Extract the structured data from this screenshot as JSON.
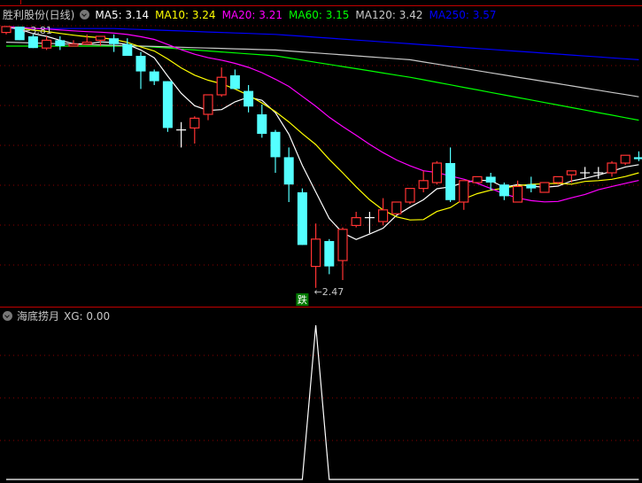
{
  "header": {
    "title": "胜利股份(日线)",
    "ma_labels": [
      {
        "text": "MA5: 3.14",
        "color": "#ffffff"
      },
      {
        "text": "MA10: 3.24",
        "color": "#ffff00"
      },
      {
        "text": "MA20: 3.21",
        "color": "#ff00ff"
      },
      {
        "text": "MA60: 3.15",
        "color": "#00ff00"
      },
      {
        "text": "MA120: 3.42",
        "color": "#c8c8c8"
      },
      {
        "text": "MA250: 3.57",
        "color": "#0000ff"
      }
    ]
  },
  "lower_panel": {
    "title": "海底捞月",
    "value_label": "XG: 0.00"
  },
  "annotations": {
    "high_label": "3.81",
    "low_label": "2.47",
    "signal_label": "跌"
  },
  "colors": {
    "up": "#ff3333",
    "down": "#54ffff",
    "flat": "#ffffff",
    "grid": "#8b0000",
    "separator": "#c00000",
    "signal_bg": "#007a00"
  },
  "chart_data": {
    "type": "candlestick",
    "price_range": [
      2.47,
      3.81
    ],
    "ohlc": [
      [
        3.78,
        3.81,
        3.77,
        3.81
      ],
      [
        3.81,
        3.81,
        3.74,
        3.74
      ],
      [
        3.76,
        3.77,
        3.7,
        3.7
      ],
      [
        3.7,
        3.76,
        3.69,
        3.74
      ],
      [
        3.74,
        3.76,
        3.69,
        3.71
      ],
      [
        3.71,
        3.74,
        3.71,
        3.72
      ],
      [
        3.72,
        3.77,
        3.72,
        3.73
      ],
      [
        3.74,
        3.76,
        3.71,
        3.76
      ],
      [
        3.75,
        3.77,
        3.68,
        3.72
      ],
      [
        3.72,
        3.75,
        3.66,
        3.66
      ],
      [
        3.66,
        3.68,
        3.49,
        3.58
      ],
      [
        3.58,
        3.59,
        3.51,
        3.53
      ],
      [
        3.53,
        3.53,
        3.27,
        3.29
      ],
      [
        3.28,
        3.32,
        3.19,
        3.28
      ],
      [
        3.29,
        3.35,
        3.21,
        3.34
      ],
      [
        3.36,
        3.46,
        3.33,
        3.46
      ],
      [
        3.46,
        3.6,
        3.45,
        3.55
      ],
      [
        3.56,
        3.59,
        3.49,
        3.49
      ],
      [
        3.48,
        3.51,
        3.37,
        3.4
      ],
      [
        3.36,
        3.41,
        3.24,
        3.26
      ],
      [
        3.27,
        3.28,
        3.06,
        3.14
      ],
      [
        3.14,
        3.19,
        2.91,
        3.0
      ],
      [
        2.96,
        2.98,
        2.69,
        2.69
      ],
      [
        2.58,
        2.8,
        2.47,
        2.72
      ],
      [
        2.71,
        2.72,
        2.54,
        2.58
      ],
      [
        2.61,
        2.78,
        2.51,
        2.77
      ],
      [
        2.79,
        2.86,
        2.78,
        2.83
      ],
      [
        2.83,
        2.86,
        2.75,
        2.83
      ],
      [
        2.81,
        2.93,
        2.79,
        2.87
      ],
      [
        2.85,
        2.91,
        2.85,
        2.91
      ],
      [
        2.91,
        2.98,
        2.9,
        2.98
      ],
      [
        2.98,
        3.07,
        2.96,
        3.02
      ],
      [
        3.01,
        3.12,
        3.0,
        3.11
      ],
      [
        3.11,
        3.19,
        2.91,
        2.92
      ],
      [
        2.91,
        3.02,
        2.87,
        3.02
      ],
      [
        3.01,
        3.04,
        3.01,
        3.04
      ],
      [
        3.04,
        3.06,
        2.97,
        3.01
      ],
      [
        3.0,
        3.01,
        2.92,
        2.94
      ],
      [
        2.91,
        3.02,
        2.91,
        2.99
      ],
      [
        3.0,
        3.04,
        2.96,
        2.98
      ],
      [
        2.96,
        3.01,
        2.96,
        3.01
      ],
      [
        3.01,
        3.04,
        3.0,
        3.04
      ],
      [
        3.05,
        3.07,
        3.01,
        3.07
      ],
      [
        3.06,
        3.09,
        3.03,
        3.06
      ],
      [
        3.06,
        3.09,
        3.03,
        3.06
      ],
      [
        3.06,
        3.12,
        3.04,
        3.11
      ],
      [
        3.11,
        3.15,
        3.1,
        3.15
      ],
      [
        3.14,
        3.17,
        3.12,
        3.13
      ]
    ],
    "computed_ma": [
      {
        "name": "MA5",
        "period": 5,
        "color": "#ffffff"
      },
      {
        "name": "MA10",
        "period": 10,
        "color": "#ffff00"
      },
      {
        "name": "MA20",
        "period": 20,
        "color": "#ff00ff"
      }
    ],
    "long_ma": [
      {
        "name": "MA60",
        "color": "#00ff00",
        "points": [
          [
            0,
            3.71
          ],
          [
            10,
            3.71
          ],
          [
            20,
            3.66
          ],
          [
            30,
            3.55
          ],
          [
            47,
            3.33
          ]
        ]
      },
      {
        "name": "MA120",
        "color": "#c8c8c8",
        "points": [
          [
            0,
            3.73
          ],
          [
            20,
            3.69
          ],
          [
            30,
            3.64
          ],
          [
            47,
            3.45
          ]
        ]
      },
      {
        "name": "MA250",
        "color": "#0000ff",
        "points": [
          [
            0,
            3.8
          ],
          [
            8,
            3.8
          ],
          [
            20,
            3.77
          ],
          [
            47,
            3.64
          ]
        ]
      }
    ],
    "high_index": 1,
    "low_index": 23,
    "indicator": {
      "name": "XG",
      "range": [
        0,
        1
      ],
      "values_nonzero": {
        "23": 1
      }
    }
  }
}
